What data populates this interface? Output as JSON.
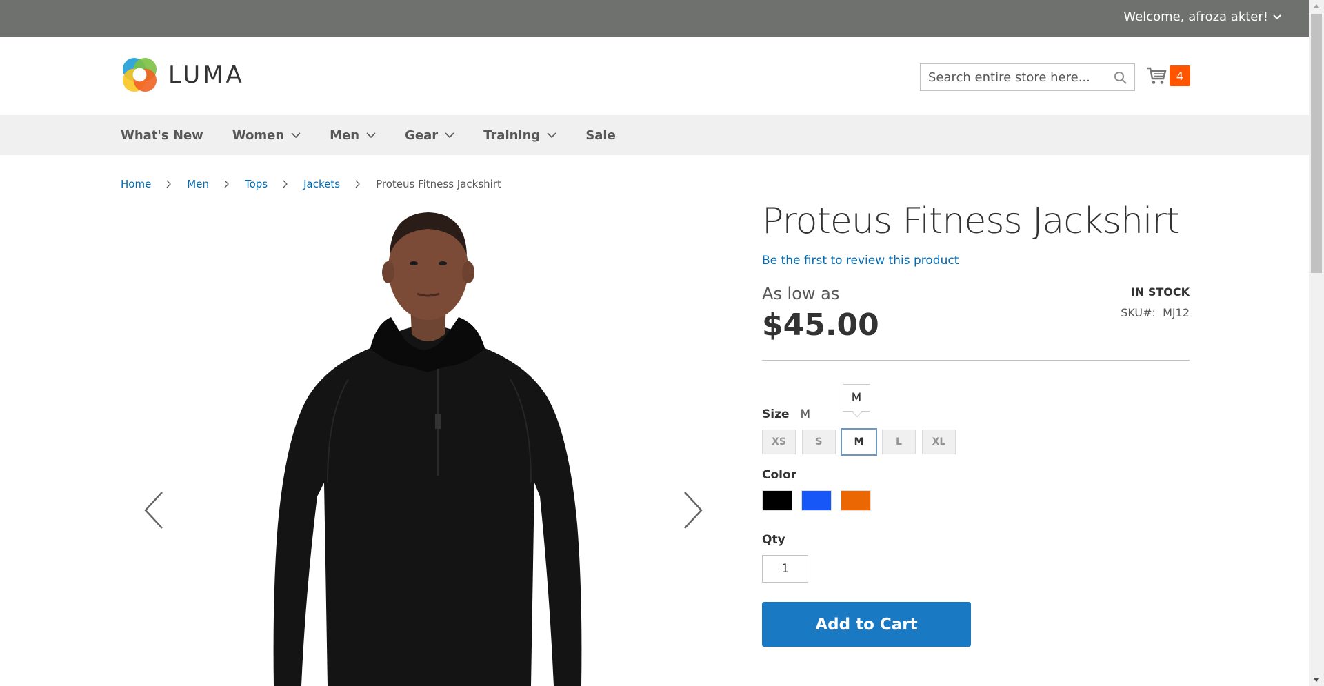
{
  "topbar": {
    "welcome": "Welcome, afroza akter!"
  },
  "header": {
    "logo_text": "LUMA",
    "search_placeholder": "Search entire store here...",
    "cart_count": "4"
  },
  "nav": {
    "items": [
      {
        "label": "What's New",
        "has_dropdown": false
      },
      {
        "label": "Women",
        "has_dropdown": true
      },
      {
        "label": "Men",
        "has_dropdown": true
      },
      {
        "label": "Gear",
        "has_dropdown": true
      },
      {
        "label": "Training",
        "has_dropdown": true
      },
      {
        "label": "Sale",
        "has_dropdown": false
      }
    ]
  },
  "breadcrumb": {
    "links": [
      "Home",
      "Men",
      "Tops",
      "Jackets"
    ],
    "current": "Proteus Fitness Jackshirt"
  },
  "product": {
    "title": "Proteus Fitness Jackshirt",
    "review_link": "Be the first to review this product",
    "price_prefix": "As low as",
    "price": "$45.00",
    "stock": "IN STOCK",
    "sku_label": "SKU#:",
    "sku_value": "MJ12",
    "size_label": "Size",
    "size_selected": "M",
    "size_tooltip": "M",
    "sizes": [
      "XS",
      "S",
      "M",
      "L",
      "XL"
    ],
    "color_label": "Color",
    "colors": [
      "#000000",
      "#1857f7",
      "#eb6703"
    ],
    "qty_label": "Qty",
    "qty_value": "1",
    "add_to_cart": "Add to Cart"
  },
  "colors": {
    "accent": "#1979c3",
    "link": "#006bb4",
    "cart_badge": "#ff5501",
    "topbar": "#6e716e"
  }
}
